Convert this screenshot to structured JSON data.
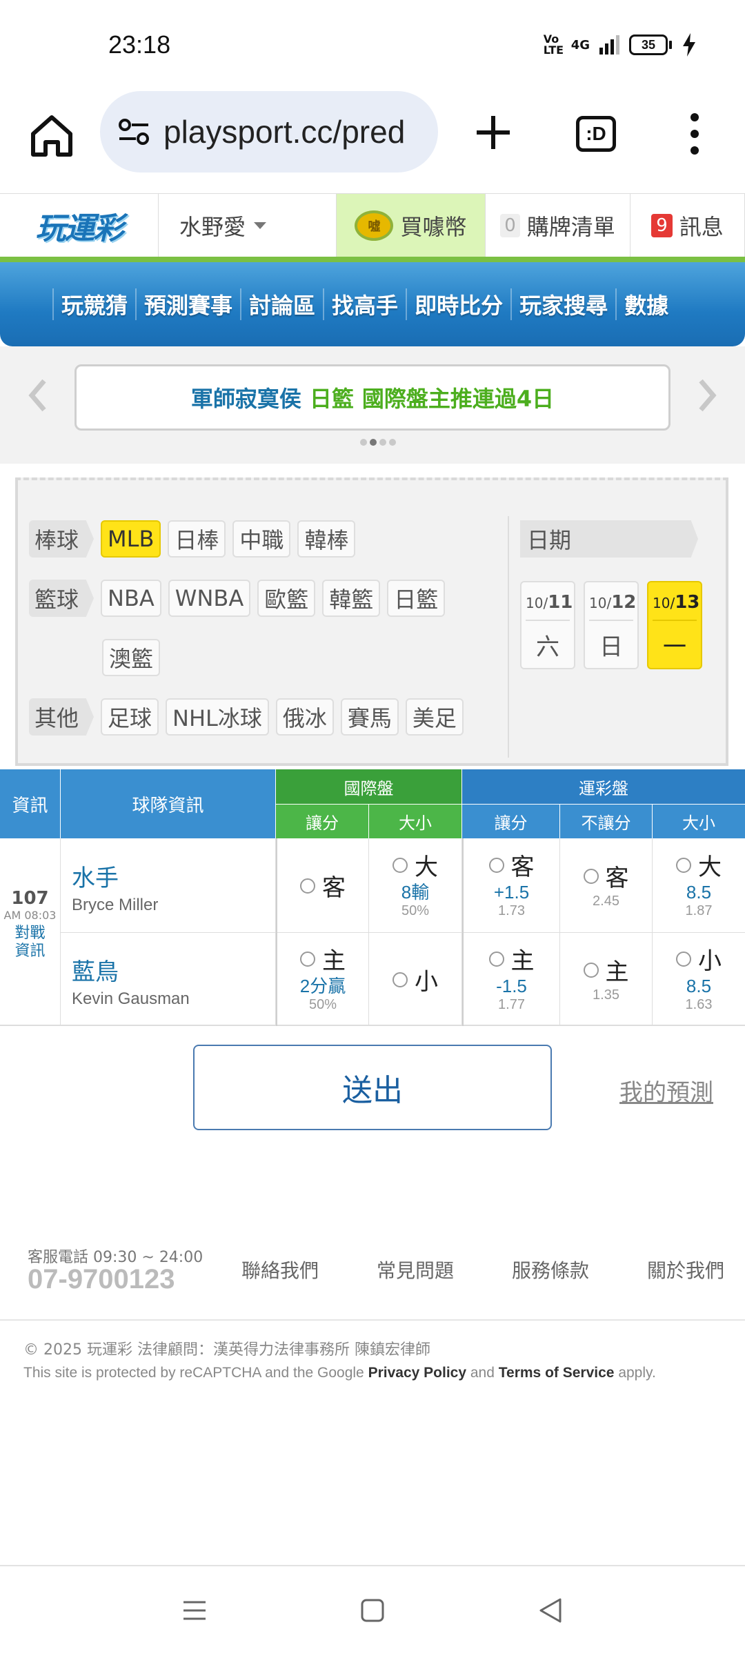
{
  "status": {
    "time": "23:18",
    "network": "4G",
    "volte": "Vo LTE",
    "battery": "35"
  },
  "browser": {
    "url": "playsport.cc/pred",
    "tabs_label": ":D"
  },
  "header": {
    "logo": "玩運彩",
    "user": "水野愛",
    "coins_icon": "噓",
    "coins": "買噱幣",
    "cart_count": "0",
    "cart": "購牌清單",
    "msg_count": "9",
    "msg": "訊息"
  },
  "nav": [
    "玩競猜",
    "預測賽事",
    "討論區",
    "找高手",
    "即時比分",
    "玩家搜尋",
    "數據"
  ],
  "banner": {
    "part1": "軍師寂寞侯",
    "part2": "日籃",
    "part3": "國際盤主推連過4日"
  },
  "filters": {
    "baseball": {
      "label": "棒球",
      "items": [
        "MLB",
        "日棒",
        "中職",
        "韓棒"
      ]
    },
    "basketball": {
      "label": "籃球",
      "items": [
        "NBA",
        "WNBA",
        "歐籃",
        "韓籃",
        "日籃",
        "澳籃"
      ]
    },
    "other": {
      "label": "其他",
      "items": [
        "足球",
        "NHL冰球",
        "俄冰",
        "賽馬",
        "美足"
      ]
    },
    "date_label": "日期",
    "dates": [
      {
        "m": "10/",
        "d": "11",
        "w": "六"
      },
      {
        "m": "10/",
        "d": "12",
        "w": "日"
      },
      {
        "m": "10/",
        "d": "13",
        "w": "一"
      }
    ]
  },
  "table": {
    "h_info": "資訊",
    "h_team": "球隊資訊",
    "h_intl": "國際盤",
    "h_sport": "運彩盤",
    "h_spread": "讓分",
    "h_total": "大小",
    "h_spread2": "讓分",
    "h_nospread": "不讓分",
    "h_total2": "大小",
    "game": {
      "num": "107",
      "time": "AM 08:03",
      "link1": "對戰",
      "link2": "資訊"
    },
    "away": {
      "team": "水手",
      "pitcher": "Bryce Miller",
      "intl_spread": "客",
      "intl_total": "大",
      "intl_total_line": "8輸",
      "intl_total_pct": "50%",
      "sp_spread": "客",
      "sp_spread_line": "+1.5",
      "sp_spread_odds": "1.73",
      "sp_ml": "客",
      "sp_ml_odds": "2.45",
      "sp_total": "大",
      "sp_total_line": "8.5",
      "sp_total_odds": "1.87"
    },
    "home": {
      "team": "藍鳥",
      "pitcher": "Kevin Gausman",
      "intl_spread": "主",
      "intl_spread_line": "2分贏",
      "intl_spread_pct": "50%",
      "intl_total": "小",
      "sp_spread": "主",
      "sp_spread_line": "-1.5",
      "sp_spread_odds": "1.77",
      "sp_ml": "主",
      "sp_ml_odds": "1.35",
      "sp_total": "小",
      "sp_total_line": "8.5",
      "sp_total_odds": "1.63"
    }
  },
  "submit": "送出",
  "my_prediction": "我的預測",
  "footer": {
    "phone_label": "客服電話 09:30 ~ 24:00",
    "phone": "07-9700123",
    "links": [
      "聯絡我們",
      "常見問題",
      "服務條款",
      "關於我們"
    ],
    "copyright": "© 2025 玩運彩 法律顧問：漢英得力法律事務所 陳鎮宏律師",
    "captcha_1": "This site is protected by reCAPTCHA and the Google",
    "captcha_privacy": "Privacy Policy",
    "captcha_and": "and",
    "captcha_terms": "Terms of Service",
    "captcha_2": "apply."
  },
  "colors": {
    "accent_blue": "#1f7ac2",
    "accent_green": "#7bc043",
    "highlight_yellow": "#ffe318"
  }
}
